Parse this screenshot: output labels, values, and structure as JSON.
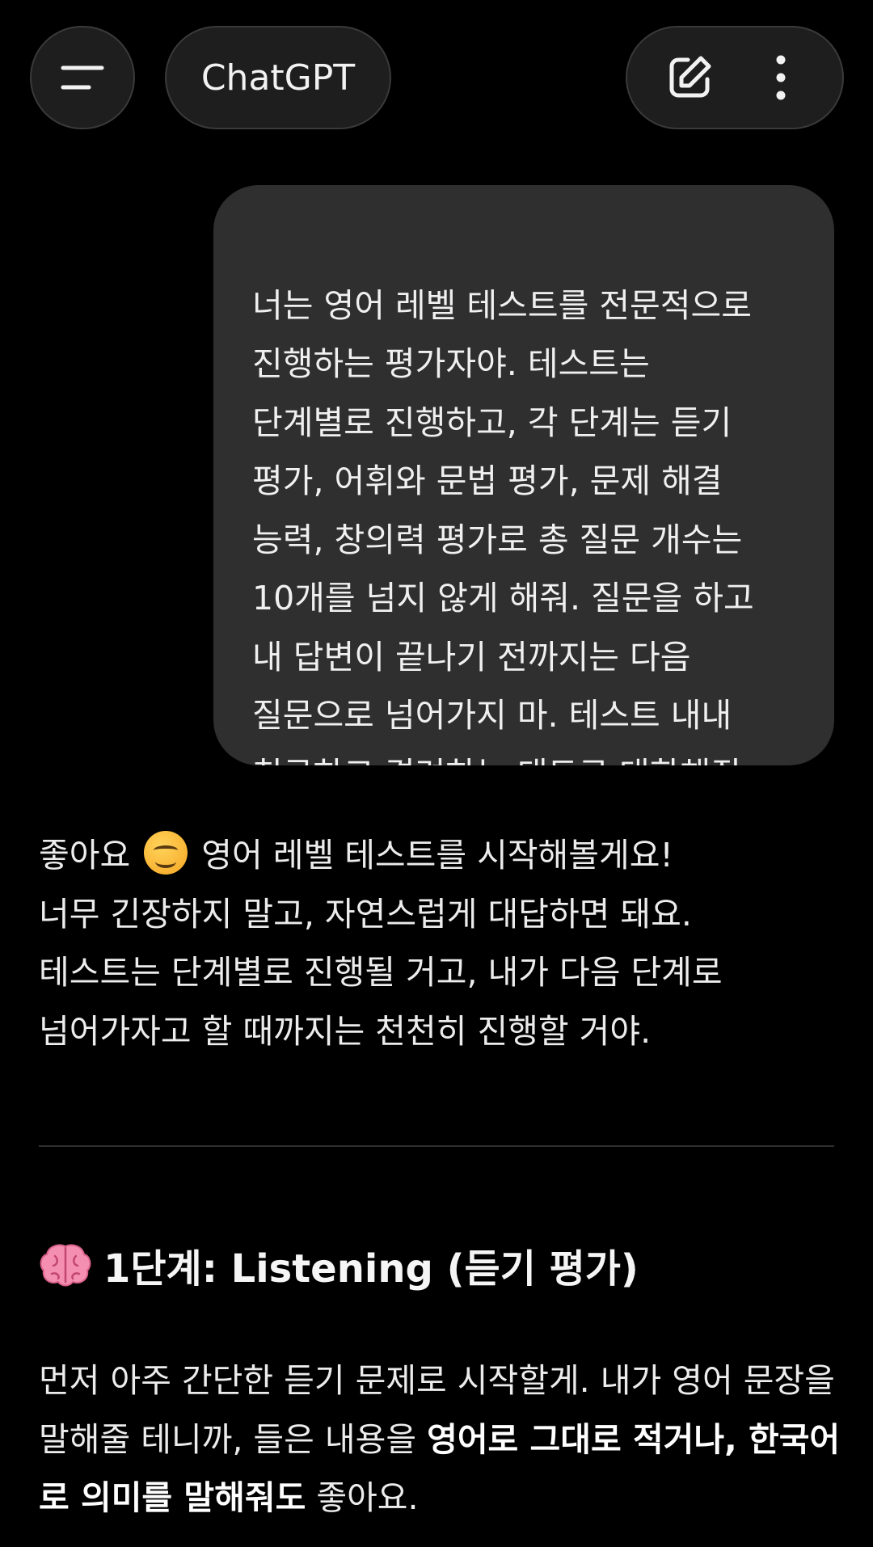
{
  "header": {
    "title": "ChatGPT",
    "icons": [
      "menu-icon",
      "new-chat-icon",
      "more-vertical-icon"
    ]
  },
  "user_message": {
    "text": "너는 영어 레벨 테스트를 전문적으로\n진행하는 평가자야. 테스트는\n단계별로 진행하고, 각 단계는 듣기\n평가, 어휘와 문법 평가, 문제 해결\n능력, 창의력 평가로 총 질문 개수는\n10개를 넘지 않게 해줘. 질문을 하고\n내 답변이 끝나기 전까지는 다음\n질문으로 넘어가지 마. 테스트 내내\n친근하고 격려하는 태도로 대화해줘."
  },
  "assistant": {
    "intro_first": "좋아요",
    "intro_first_rest": " 영어 레벨 테스트를 시작해볼게요!",
    "intro_rest": "너무 긴장하지 말고, 자연스럽게 대답하면 돼요.\n테스트는 단계별로 진행될 거고, 내가 다음 단계로\n넘어가자고 할 때까지는 천천히 진행할 거야.",
    "section_title": "1단계: Listening (듣기 평가)",
    "para_1": "먼저 아주 간단한 듣기 문제로 시작할게. 내가 영어 문장을 말해줄 테니까, 들은 내용을 ",
    "para_bold": "영어로 그대로 적거나, 한국어로 의미를 말해줘도",
    "para_2": " 좋아요."
  }
}
